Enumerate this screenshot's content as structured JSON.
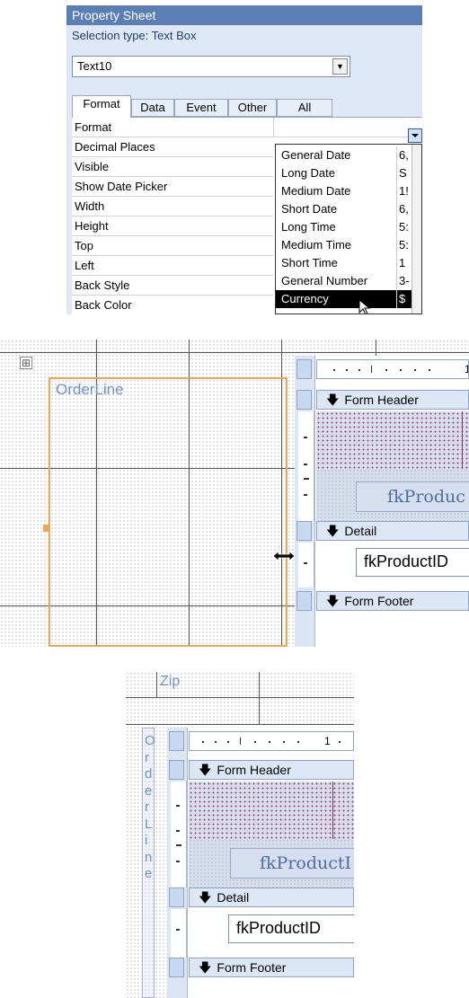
{
  "property_sheet": {
    "title": "Property Sheet",
    "selection_type": "Selection type:  Text Box",
    "control_name": "Text10",
    "tabs": [
      "Format",
      "Data",
      "Event",
      "Other",
      "All"
    ],
    "properties": [
      "Format",
      "Decimal Places",
      "Visible",
      "Show Date Picker",
      "Width",
      "Height",
      "Top",
      "Left",
      "Back Style",
      "Back Color"
    ],
    "format_options": [
      {
        "name": "General Date",
        "preview": "6,"
      },
      {
        "name": "Long Date",
        "preview": "S"
      },
      {
        "name": "Medium Date",
        "preview": "1!"
      },
      {
        "name": "Short Date",
        "preview": "6,"
      },
      {
        "name": "Long Time",
        "preview": "5:"
      },
      {
        "name": "Medium Time",
        "preview": "5:"
      },
      {
        "name": "Short Time",
        "preview": "1"
      },
      {
        "name": "General Number",
        "preview": "3-"
      },
      {
        "name": "Currency",
        "preview": "$"
      }
    ],
    "selected_option": "Currency"
  },
  "design1": {
    "caption": "OrderLine",
    "form_header": "Form Header",
    "detail": "Detail",
    "form_footer": "Form Footer",
    "header_control": "fkProduc",
    "detail_control": "fkProductID",
    "ruler_mark": "1"
  },
  "design2": {
    "caption_top": "Zip",
    "caption_vertical": [
      "O",
      "r",
      "d",
      "e",
      "r",
      "L",
      "i",
      "n",
      "e"
    ],
    "form_header": "Form Header",
    "detail": "Detail",
    "form_footer": "Form Footer",
    "header_control": "fkProductI",
    "detail_control": "fkProductID",
    "ruler_mark": "1"
  }
}
